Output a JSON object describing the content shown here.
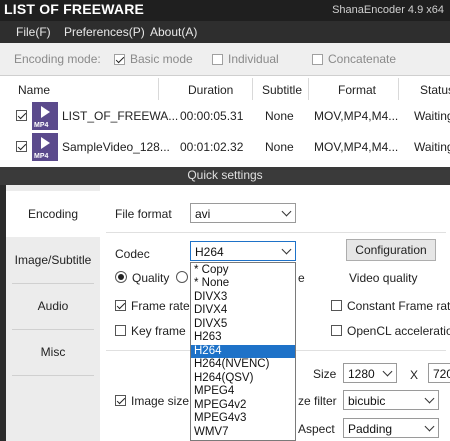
{
  "window": {
    "title": "LIST OF FREEWARE",
    "version": "ShanaEncoder 4.9 x64"
  },
  "menu": [
    "File(F)",
    "Preferences(P)",
    "About(A)"
  ],
  "mode_bar": {
    "label": "Encoding mode:",
    "options": [
      {
        "label": "Basic mode",
        "checked": true
      },
      {
        "label": "Individual",
        "checked": false
      },
      {
        "label": "Concatenate",
        "checked": false
      }
    ]
  },
  "file_list": {
    "columns": [
      "Name",
      "Duration",
      "Subtitle",
      "Format",
      "Status"
    ],
    "rows": [
      {
        "checked": true,
        "thumb": "MP4",
        "name": "LIST_OF_FREEWA...",
        "duration": "00:00:05.31",
        "subtitle": "None",
        "format": "MOV,MP4,M4...",
        "status": "Waiting..."
      },
      {
        "checked": true,
        "thumb": "MP4",
        "name": "SampleVideo_128...",
        "duration": "00:01:02.32",
        "subtitle": "None",
        "format": "MOV,MP4,M4...",
        "status": "Waiting..."
      }
    ]
  },
  "quick_settings": {
    "title": "Quick settings",
    "tabs": [
      "Encoding",
      "Image/Subtitle",
      "Audio",
      "Misc"
    ],
    "file_format_label": "File format",
    "file_format_value": "avi",
    "codec_label": "Codec",
    "codec_value": "H264",
    "configuration_label": "Configuration",
    "quality_label": "Quality",
    "quality_partial": "e",
    "video_quality_label": "Video quality",
    "frame_rate_label": "Frame rate",
    "frame_rate_checked": true,
    "constant_frame_rate_label": "Constant Frame rate",
    "key_frame_label": "Key frame",
    "opencl_label": "OpenCL acceleration",
    "image_size_label": "Image size",
    "image_size_checked": true,
    "size_label": "Size",
    "width_value": "1280",
    "x_label": "X",
    "height_value": "720",
    "resize_filter_label": "ze filter",
    "resize_filter_value": "bicubic",
    "aspect_label": "Aspect",
    "aspect_value": "Padding"
  },
  "codec_dropdown": {
    "options": [
      "* Copy",
      "* None",
      "DIVX3",
      "DIVX4",
      "DIVX5",
      "H263",
      "H264",
      "H264(NVENC)",
      "H264(QSV)",
      "MPEG4",
      "MPEG4v2",
      "MPEG4v3",
      "WMV7"
    ],
    "selected": "H264"
  },
  "colors": {
    "accent": "#1e72c8",
    "titlebar": "#1f1f1f",
    "thumb": "#5b4a8c"
  }
}
